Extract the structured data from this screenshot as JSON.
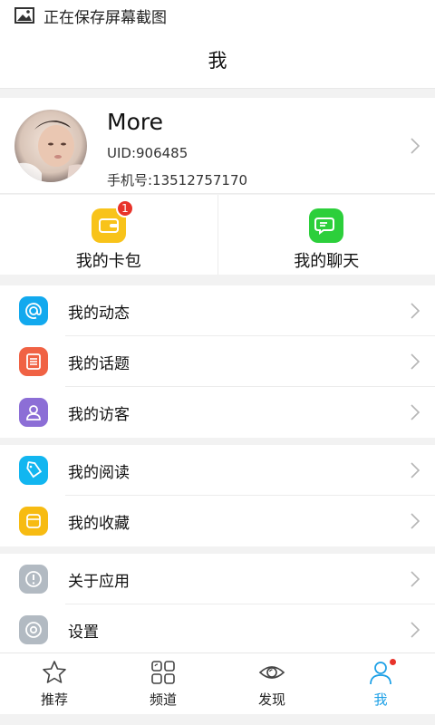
{
  "status_bar": {
    "text": "正在保存屏幕截图",
    "icon": "image-icon"
  },
  "header": {
    "title": "我"
  },
  "profile": {
    "name": "More",
    "uid": "UID:906485",
    "phone": "手机号:13512757170"
  },
  "quick_actions": [
    {
      "label": "我的卡包",
      "icon": "wallet-icon",
      "color": "#f8c31a",
      "badge": "1"
    },
    {
      "label": "我的聊天",
      "icon": "chat-icon",
      "color": "#2ccf3b"
    }
  ],
  "menu_groups": [
    {
      "items": [
        {
          "label": "我的动态",
          "icon": "at-icon",
          "color": "#12a9ee"
        },
        {
          "label": "我的话题",
          "icon": "list-icon",
          "color": "#f06244"
        },
        {
          "label": "我的访客",
          "icon": "person-icon",
          "color": "#8c6ed6"
        }
      ]
    },
    {
      "items": [
        {
          "label": "我的阅读",
          "icon": "tag-icon",
          "color": "#12b6f0"
        },
        {
          "label": "我的收藏",
          "icon": "bookmark-icon",
          "color": "#f7bb12"
        }
      ]
    },
    {
      "items": [
        {
          "label": "关于应用",
          "icon": "info-icon",
          "color": "#b2bac2"
        },
        {
          "label": "设置",
          "icon": "settings-icon",
          "color": "#b2bac2"
        }
      ]
    }
  ],
  "tabs": [
    {
      "label": "推荐",
      "icon": "star-icon"
    },
    {
      "label": "频道",
      "icon": "grid-icon"
    },
    {
      "label": "发现",
      "icon": "eye-icon"
    },
    {
      "label": "我",
      "icon": "profile-icon",
      "active": true
    }
  ],
  "colors": {
    "accent": "#1a9fe6",
    "badge": "#e8332a"
  }
}
